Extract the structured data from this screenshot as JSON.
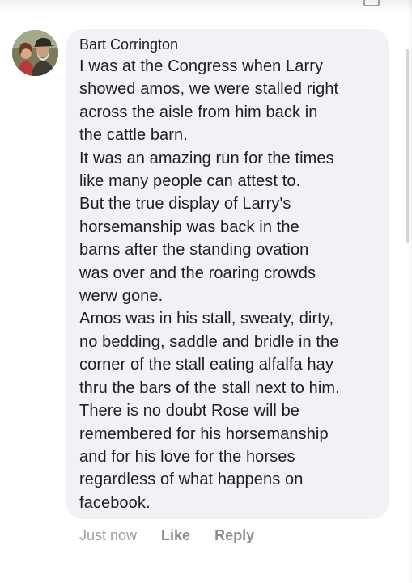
{
  "comment": {
    "author": "Bart Corrington",
    "text": "I was at the Congress when Larry\nshowed amos, we were stalled right\nacross the aisle from him back in\nthe cattle barn.\nIt was an amazing run for the times\nlike many people can attest to.\nBut the true display of Larry's\nhorsemanship was back in the\nbarns after the standing ovation\nwas over and the roaring crowds\nwerw gone.\nAmos was in his stall, sweaty, dirty,\nno bedding, saddle and bridle in the\ncorner of the stall eating alfalfa hay\nthru the bars of the stall next to him.\nThere is no doubt Rose will be\nremembered for his horsemanship\nand for his love for the horses\nregardless of what happens on\nfacebook."
  },
  "actions": {
    "timestamp": "Just now",
    "like_label": "Like",
    "reply_label": "Reply"
  },
  "icons": {
    "avatar": "profile-photo",
    "top_right": "partial-top-icon"
  }
}
